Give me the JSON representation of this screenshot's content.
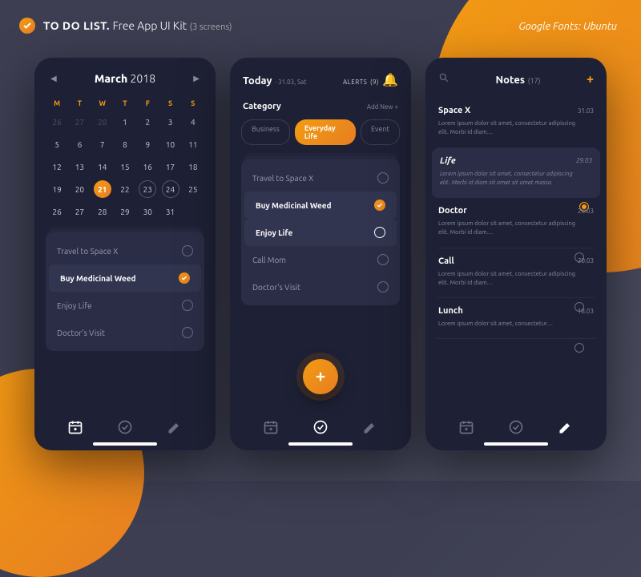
{
  "header": {
    "title": "TO DO LIST.",
    "subtitle": "Free App UI Kit",
    "count": "(3 screens)"
  },
  "fonts_label": "Google Fonts: Ubuntu",
  "calendar": {
    "month": "March",
    "year": "2018",
    "weekdays": [
      "M",
      "T",
      "W",
      "T",
      "F",
      "S",
      "S"
    ],
    "prev_days": [
      "26",
      "27",
      "28"
    ],
    "selected": "21",
    "ringed": [
      "23",
      "24"
    ],
    "tasks": [
      {
        "label": "Travel to Space X",
        "state": "open"
      },
      {
        "label": "Buy Medicinal Weed",
        "state": "done"
      },
      {
        "label": "Enjoy Life",
        "state": "open"
      },
      {
        "label": "Doctor's Visit",
        "state": "open"
      }
    ]
  },
  "today": {
    "title": "Today",
    "date": "· 31.03, Sat",
    "alerts_label": "ALERTS",
    "alerts_count": "(9)",
    "category_label": "Category",
    "addnew": "Add New +",
    "chips": [
      "Business",
      "Everyday Life",
      "Event"
    ],
    "active_chip": 1,
    "tasks": [
      {
        "label": "Travel to Space X",
        "state": "open"
      },
      {
        "label": "Buy Medicinal Weed",
        "state": "done"
      },
      {
        "label": "Enjoy Life",
        "state": "open-bold"
      },
      {
        "label": "Call Mom",
        "state": "open"
      },
      {
        "label": "Doctor's Visit",
        "state": "open"
      }
    ]
  },
  "notes": {
    "title": "Notes",
    "count": "(17)",
    "items": [
      {
        "title": "Space X",
        "date": "31.03",
        "body": "Lorem ipsum dolor sit amet, consectetur adipiscing elit. Morbi id diam…",
        "hl": false
      },
      {
        "title": "Life",
        "date": "29.03",
        "body": "Lorem ipsum dolor sit amet, consectetur adipiscing elit. Morbi id diam sit amet sit amet massa.",
        "hl": true
      },
      {
        "title": "Doctor",
        "date": "28.03",
        "body": "Lorem ipsum dolor sit amet, consectetur adipiscing elit. Morbi id diam…",
        "hl": false
      },
      {
        "title": "Call",
        "date": "20.03",
        "body": "Lorem ipsum dolor sit amet, consectetur adipiscing elit. Morbi id diam…",
        "hl": false
      },
      {
        "title": "Lunch",
        "date": "18.03",
        "body": "Lorem ipsum dolor sit amet, consectetur…",
        "hl": false
      }
    ]
  },
  "icons": {
    "cal": "calendar-add",
    "check": "check-circle",
    "pen": "pencil"
  }
}
